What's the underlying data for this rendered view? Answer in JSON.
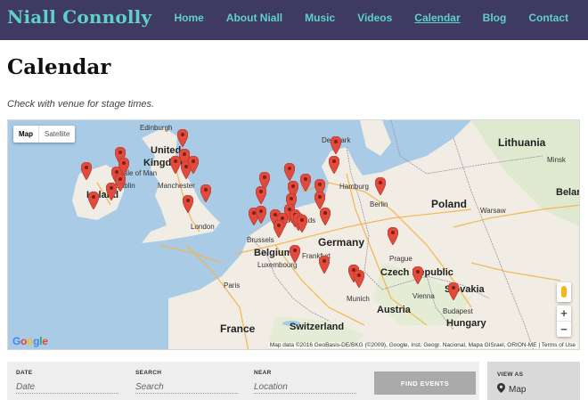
{
  "site": {
    "title": "Niall Connolly"
  },
  "nav": [
    {
      "label": "Home",
      "active": false
    },
    {
      "label": "About Niall",
      "active": false
    },
    {
      "label": "Music",
      "active": false
    },
    {
      "label": "Videos",
      "active": false
    },
    {
      "label": "Calendar",
      "active": true
    },
    {
      "label": "Blog",
      "active": false
    },
    {
      "label": "Contact",
      "active": false
    }
  ],
  "page": {
    "title": "Calendar",
    "subtitle": "Check with venue for stage times."
  },
  "map": {
    "type_controls": [
      "Map",
      "Satellite"
    ],
    "selected_type": "Map",
    "labels": {
      "denmark": "Denmark",
      "lithuania": "Lithuania",
      "minsk": "Minsk",
      "edinburgh": "Edinburgh",
      "united": "United",
      "kingdom": "Kingdom",
      "isle_of_man": "Isle of Man",
      "ireland": "Ireland",
      "manchester": "Manchester",
      "hamburg": "Hamburg",
      "belarus": "Belarus",
      "poland": "Poland",
      "berlin": "Berlin",
      "warsaw": "Warsaw",
      "london": "London",
      "netherlands": "Netherlands",
      "brussels": "Brussels",
      "belgium": "Belgium",
      "germany": "Germany",
      "frankfurt": "Frankfurt",
      "luxembourg": "Luxembourg",
      "prague": "Prague",
      "czech_republic": "Czech Republic",
      "paris": "Paris",
      "munich": "Munich",
      "vienna": "Vienna",
      "slovakia": "Slovakia",
      "austria": "Austria",
      "budapest": "Budapest",
      "hungary": "Hungary",
      "switzerland": "Switzerland",
      "france": "France",
      "isle_label_dublin": "Dublin"
    },
    "logo": "Google",
    "attribution": "Map data ©2016 GeoBasis-DE/BKG (©2009), Google, Inst. Geogr. Nacional, Mapa GISrael, ORION-ME | Terms of Use",
    "zoom_in": "+",
    "zoom_out": "−",
    "pin_color": "#e24b3b",
    "pin_count": 45
  },
  "filters": {
    "date": {
      "label": "DATE",
      "placeholder": "Date"
    },
    "search": {
      "label": "SEARCH",
      "placeholder": "Search"
    },
    "near": {
      "label": "NEAR",
      "placeholder": "Location"
    },
    "find_button": "FIND EVENTS",
    "view_as": {
      "label": "VIEW AS",
      "value": "Map",
      "icon": "map-pin-icon"
    }
  }
}
